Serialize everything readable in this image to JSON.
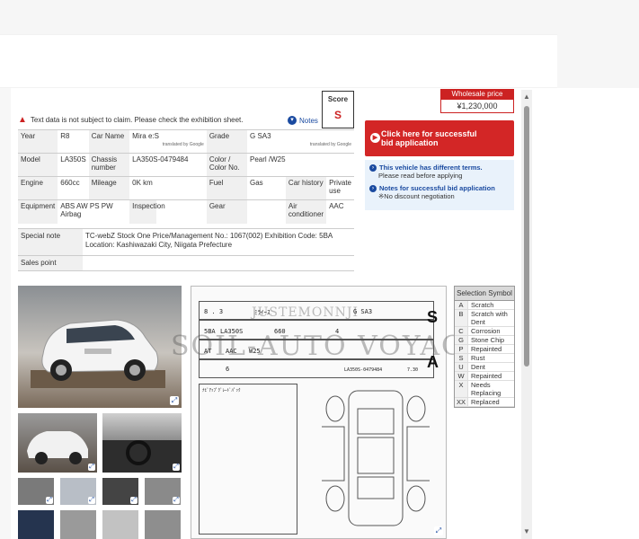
{
  "warning": {
    "text": "Text data is not subject to claim. Please check the exhibition sheet."
  },
  "notes_label": "Notes",
  "score": {
    "label": "Score",
    "value": "S"
  },
  "translated": "translated by Google",
  "spec": {
    "year_k": "Year",
    "year_v": "R8",
    "carname_k": "Car Name",
    "carname_v": "Mira e:S",
    "grade_k": "Grade",
    "grade_v": "G SA3",
    "model_k": "Model",
    "model_v": "LA350S",
    "chassis_k": "Chassis number",
    "chassis_v": "LA350S-0479484",
    "color_k": "Color / Color No.",
    "color_v": "Pearl /W25",
    "engine_k": "Engine",
    "engine_v": "660cc",
    "mileage_k": "Mileage",
    "mileage_v": "0K km",
    "fuel_k": "Fuel",
    "fuel_v": "Gas",
    "history_k": "Car history",
    "history_v": "Private use",
    "equip_k": "Equipment",
    "equip_v": "ABS AW PS PW Airbag",
    "inspection_k": "Inspection",
    "inspection_v": "",
    "gear_k": "Gear",
    "gear_v": "",
    "ac_k": "Air conditioner",
    "ac_v": "AAC"
  },
  "special": {
    "note_k": "Special note",
    "note_v1": "TC-webZ Stock One Price/Management No.: 1067(002) Exhibition Code: 5BA",
    "note_v2": "Location: Kashiwazaki City, Niigata Prefecture",
    "sales_k": "Sales point"
  },
  "wholesale": {
    "label": "Wholesale price",
    "value": "¥1,230,000"
  },
  "bid": {
    "label1": "Click here for successful",
    "label2": "bid application"
  },
  "info": {
    "t1": "This vehicle has different terms.",
    "s1": "Please read before applying",
    "t2": "Notes for successful bid application",
    "s2": "※No discount negotiation"
  },
  "sheet": {
    "row1_a": "8 . 3",
    "row1_b": "ﾐﾗｲｰｽ",
    "row1_c": "G SA3",
    "grade_big": "S",
    "row2_a": "5BA",
    "row2_b": "LA350S",
    "row2_c": "660",
    "row2_d": "4",
    "row3_a": "AT",
    "row3_b": "AAC",
    "row3_c": "W25",
    "row4_a": "6",
    "row4_b": "LA350S-0479484",
    "row4_c": "7.30",
    "interior_big": "A",
    "memo": "ﾅﾋﾞｱｯﾌﾟｸﾞﾚｰﾄﾞﾊﾟｯｸ"
  },
  "watermark": {
    "top": "JUSTEMONNJI",
    "main": "SOIL-AUTO VOYAG"
  },
  "legend": {
    "header": "Selection Symbol",
    "items": [
      {
        "c": "A",
        "d": "Scratch"
      },
      {
        "c": "B",
        "d": "Scratch with Dent"
      },
      {
        "c": "C",
        "d": "Corrosion"
      },
      {
        "c": "G",
        "d": "Stone Chip"
      },
      {
        "c": "P",
        "d": "Repainted"
      },
      {
        "c": "S",
        "d": "Rust"
      },
      {
        "c": "U",
        "d": "Dent"
      },
      {
        "c": "W",
        "d": "Repainted"
      },
      {
        "c": "X",
        "d": "Needs Replacing"
      },
      {
        "c": "XX",
        "d": "Replaced"
      }
    ]
  },
  "colors": {
    "accent_red": "#d32626",
    "link_blue": "#1a4aa0"
  }
}
